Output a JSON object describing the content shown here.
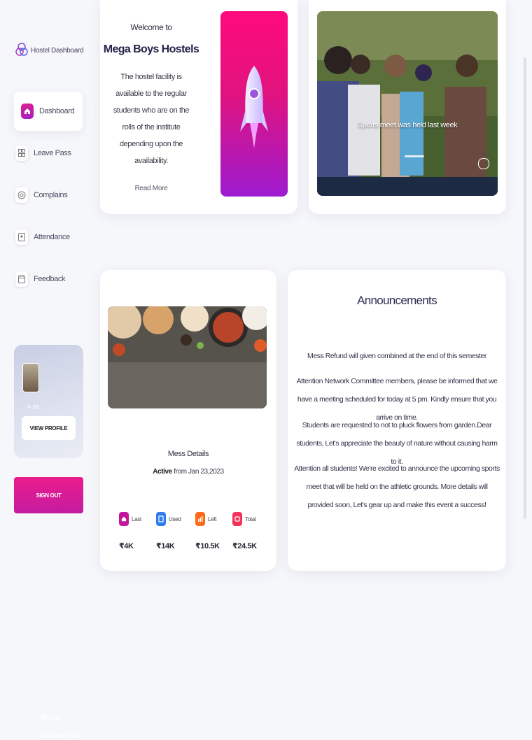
{
  "sidebar": {
    "brand": "Hostel Dashboard",
    "items": [
      {
        "label": "Dashboard",
        "icon": "home-icon"
      },
      {
        "label": "Leave Pass",
        "icon": "grid-icon"
      },
      {
        "label": "Complains",
        "icon": "target-icon"
      },
      {
        "label": "Attendance",
        "icon": "id-card-icon"
      },
      {
        "label": "Feedback",
        "icon": "calendar-icon"
      }
    ],
    "active": "Dashboard"
  },
  "profile": {
    "first_name": "Nand",
    "last_name": "kishore ola",
    "room": "F-28",
    "view_label": "VIEW PROFILE"
  },
  "sign_out_label": "SIGN OUT",
  "welcome": {
    "greeting": "Welcome to",
    "title": "Mega Boys Hostels",
    "body": "The hostel facility is available to the regular students who are on the rolls of the institute depending upon the availability.",
    "read_more": "Read More"
  },
  "photo": {
    "caption": "Sports meet was held last week"
  },
  "mess": {
    "title": "Mess Details",
    "status_word": "Active",
    "status_rest": "from Jan 23,2023",
    "stats": [
      {
        "label": "Last",
        "value": "₹4K",
        "color": "#c4169c"
      },
      {
        "label": "Used",
        "value": "₹14K",
        "color": "#2f7cf0"
      },
      {
        "label": "Left",
        "value": "₹10.5K",
        "color": "#ff6a1a"
      },
      {
        "label": "Total",
        "value": "₹24.5K",
        "color": "#f0345a"
      }
    ]
  },
  "announcements": {
    "title": "Announcements",
    "items": [
      "Mess Refund will given combined at the end of this semester",
      "Attention Network Committee members, please be informed that we have a meeting scheduled for today at 5 pm. Kindly ensure that you arrive on time.",
      "Students are requested to not to pluck flowers from garden.Dear students, Let's appreciate the beauty of nature without causing harm to it.",
      "Attention all students! We're excited to announce the upcoming sports meet that will be held on the athletic grounds. More details will provided soon, Let's gear up and make this event a success!"
    ]
  },
  "colors": {
    "accent": "#e0208a",
    "accent_dark": "#a01dc8",
    "heading": "#2a2f55",
    "background": "#f6f7fb"
  }
}
